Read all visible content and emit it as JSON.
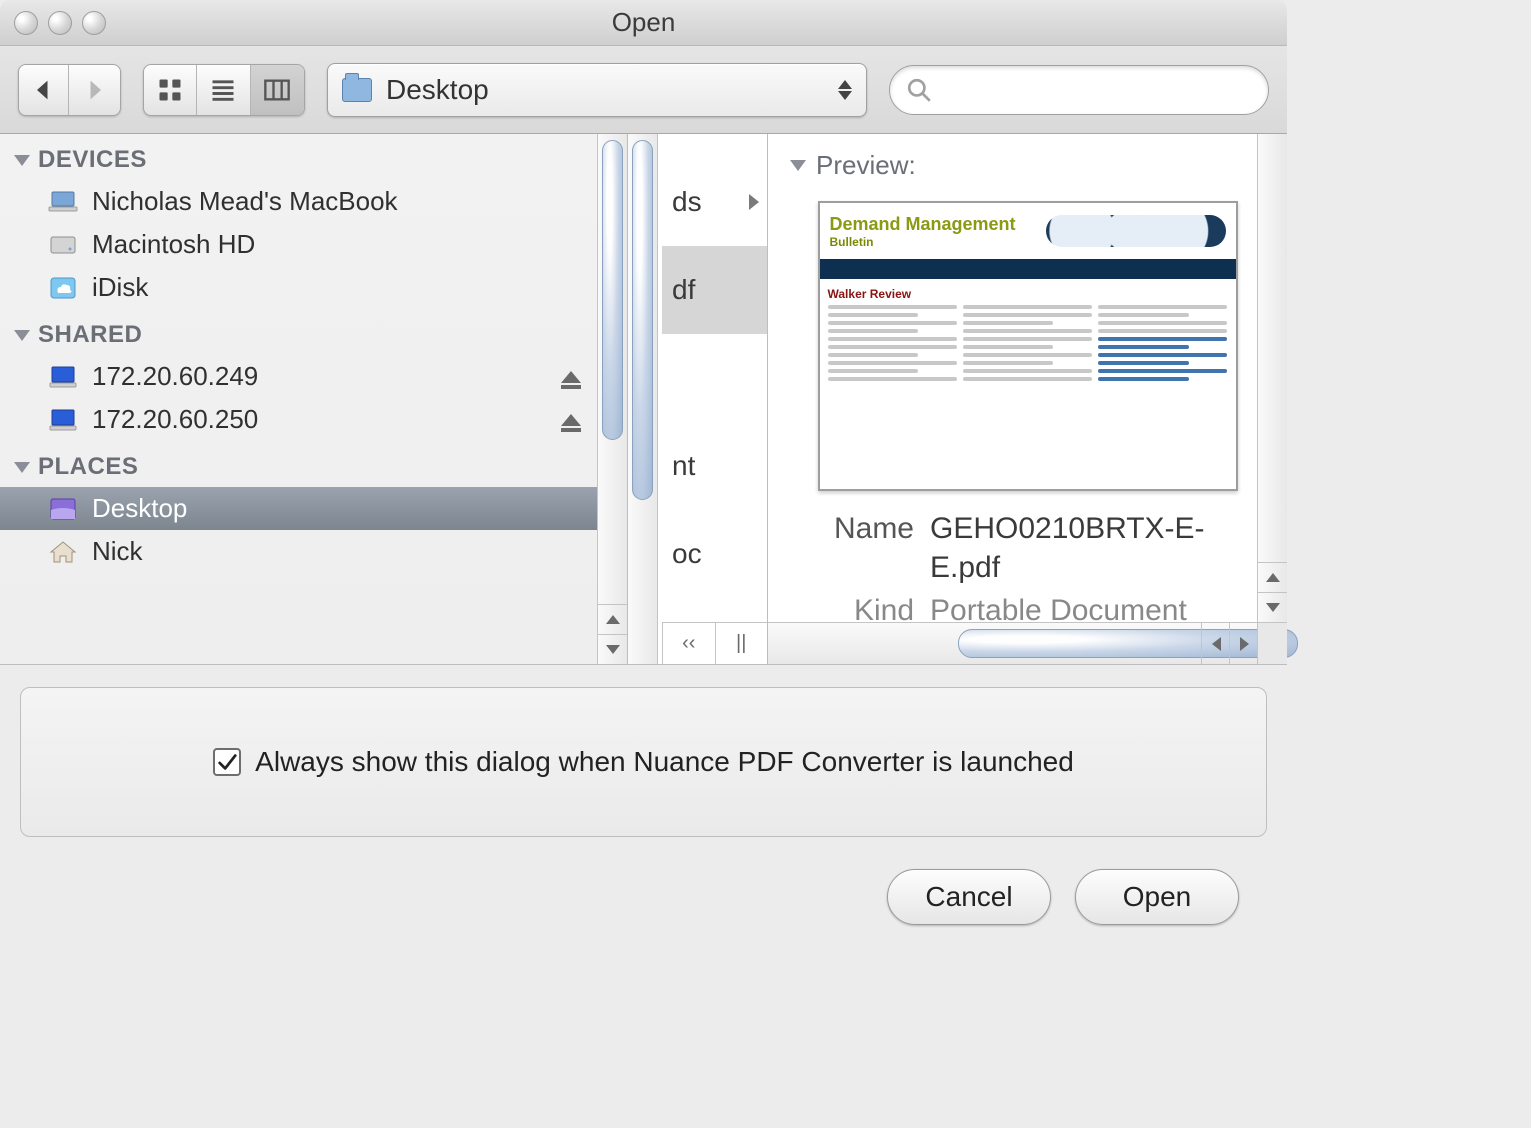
{
  "window": {
    "title": "Open"
  },
  "nav": {
    "back": "◀",
    "forward": "▶"
  },
  "path_popup": {
    "location": "Desktop"
  },
  "search": {
    "placeholder": ""
  },
  "sidebar": {
    "sections": [
      {
        "title": "DEVICES",
        "items": [
          {
            "label": "Nicholas Mead's MacBook",
            "icon": "laptop",
            "eject": false
          },
          {
            "label": "Macintosh HD",
            "icon": "hdd",
            "eject": false
          },
          {
            "label": "iDisk",
            "icon": "idisk",
            "eject": false
          }
        ]
      },
      {
        "title": "SHARED",
        "items": [
          {
            "label": "172.20.60.249",
            "icon": "netpc",
            "eject": true
          },
          {
            "label": "172.20.60.250",
            "icon": "netpc",
            "eject": true
          }
        ]
      },
      {
        "title": "PLACES",
        "items": [
          {
            "label": "Desktop",
            "icon": "desktop",
            "selected": true
          },
          {
            "label": "Nick",
            "icon": "home"
          }
        ]
      }
    ]
  },
  "file_list": {
    "rows": [
      {
        "text": "ds",
        "arrow": true
      },
      {
        "text": "df",
        "selected": true
      },
      {
        "text": "nt"
      },
      {
        "text": "oc"
      }
    ],
    "top_arrow": "▶"
  },
  "preview": {
    "header": "Preview:",
    "doc_title": "Demand Management",
    "doc_sub": "Bulletin",
    "doc_section": "Walker Review",
    "meta": {
      "name_label": "Name",
      "name_value": "GEHO0210BRTX-E-E.pdf",
      "kind_label": "Kind",
      "kind_value": "Portable Document"
    }
  },
  "options": {
    "checkbox_checked": true,
    "label": "Always show this dialog when Nuance PDF Converter is launched"
  },
  "buttons": {
    "cancel": "Cancel",
    "open": "Open"
  }
}
